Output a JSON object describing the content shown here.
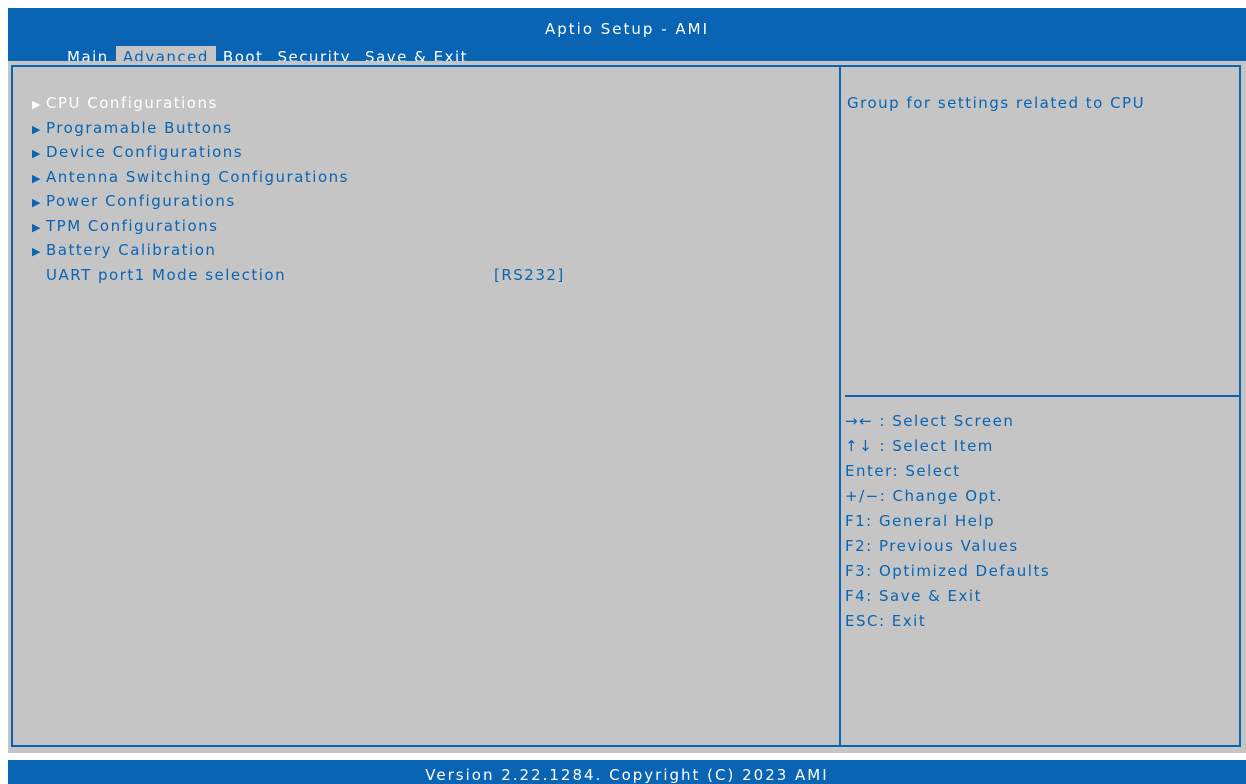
{
  "window": {
    "title": "Aptio Setup - AMI"
  },
  "tabs": [
    {
      "label": "Main"
    },
    {
      "label": "Advanced"
    },
    {
      "label": "Boot"
    },
    {
      "label": "Security"
    },
    {
      "label": "Save & Exit"
    }
  ],
  "active_tab": "Advanced",
  "menu": {
    "items": [
      {
        "label": "CPU Configurations"
      },
      {
        "label": "Programable Buttons"
      },
      {
        "label": "Device Configurations"
      },
      {
        "label": "Antenna Switching Configurations"
      },
      {
        "label": "Power Configurations"
      },
      {
        "label": "TPM Configurations"
      },
      {
        "label": "Battery Calibration"
      }
    ],
    "selected_item": "CPU Configurations",
    "setting": {
      "label": "UART port1 Mode selection",
      "value": "[RS232]"
    }
  },
  "help": {
    "text": "Group for settings related to CPU"
  },
  "keys": [
    {
      "text": "→← : Select Screen"
    },
    {
      "text": "↑↓ : Select Item"
    },
    {
      "text": "Enter: Select"
    },
    {
      "text": "+/−: Change Opt."
    },
    {
      "text": "F1: General Help"
    },
    {
      "text": "F2: Previous Values"
    },
    {
      "text": "F3: Optimized Defaults"
    },
    {
      "text": "F4: Save & Exit"
    },
    {
      "text": "ESC: Exit"
    }
  ],
  "footer": {
    "text": "Version 2.22.1284. Copyright (C) 2023 AMI"
  },
  "colors": {
    "accent": "#0a64b4",
    "panel": "#c5c5c5",
    "highlight": "#ffffff"
  },
  "icons": {
    "submenu_marker": "triangle-right-icon"
  }
}
